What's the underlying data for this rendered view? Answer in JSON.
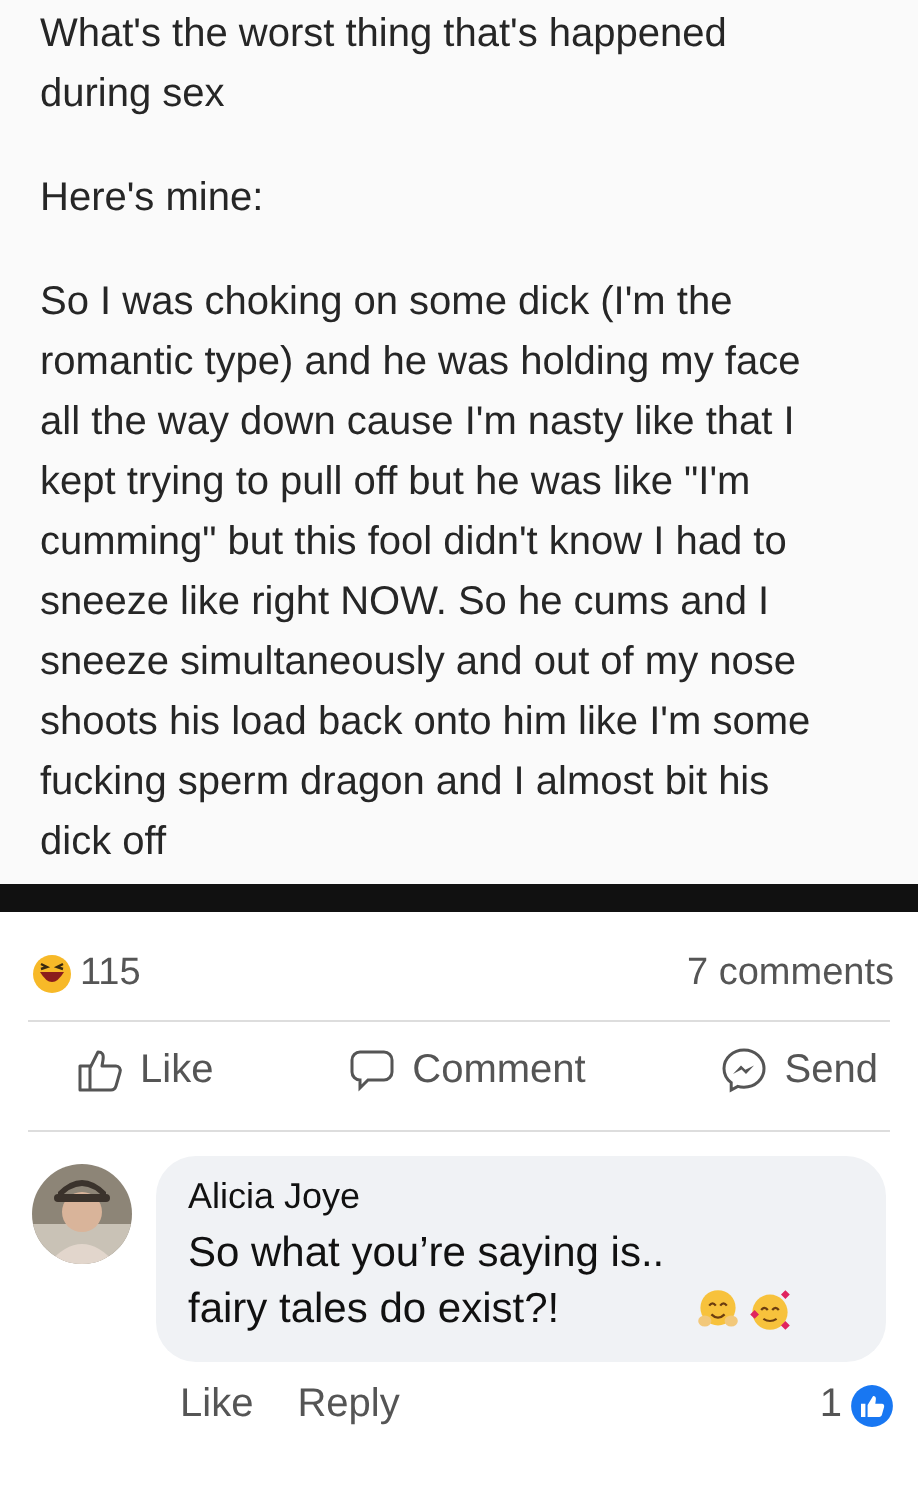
{
  "post": {
    "paragraphs": [
      "What's the worst thing that's happened during sex",
      "Here's mine:",
      "So I was choking on some dick (I'm the romantic type) and he was holding my face all the way down cause I'm nasty like that I kept trying to pull off but he was like \"I'm cumming\" but this fool didn't know I had to sneeze like right NOW. So he cums and I sneeze simultaneously and out of my nose shoots his load back onto him like I'm some fucking sperm dragon and I almost bit his dick off"
    ]
  },
  "reactions": {
    "count": "115",
    "comments": "7 comments"
  },
  "actions": [
    {
      "kind": "like",
      "label": "Like"
    },
    {
      "kind": "comment",
      "label": "Comment"
    },
    {
      "kind": "send",
      "label": "Send"
    }
  ],
  "comment": {
    "author": "Alicia Joye",
    "text": "So what you’re saying is.. fairy tales do exist?!",
    "avatar": {
      "kind": "picture"
    },
    "actions": [
      "Like",
      "Reply"
    ],
    "likes": "1"
  }
}
